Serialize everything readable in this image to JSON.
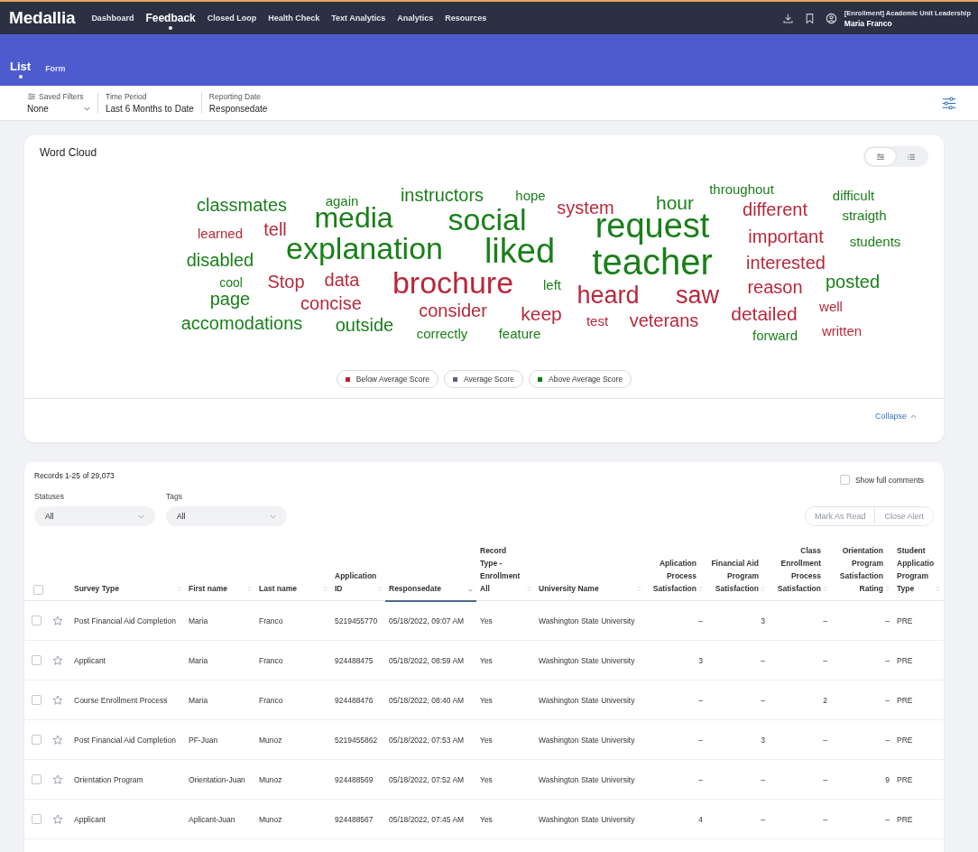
{
  "nav": {
    "logo": "Medallia",
    "items": [
      {
        "label": "Dashboard",
        "selected": false
      },
      {
        "label": "Feedback",
        "selected": true
      },
      {
        "label": "Closed Loop",
        "selected": false
      },
      {
        "label": "Health Check",
        "selected": false
      },
      {
        "label": "Text Analytics",
        "selected": false
      },
      {
        "label": "Analytics",
        "selected": false
      },
      {
        "label": "Resources",
        "selected": false
      }
    ],
    "account": "[Enrollment] Academic Unit Leadership",
    "user": "Maria Franco"
  },
  "subtabs": [
    {
      "label": "List",
      "selected": true
    },
    {
      "label": "Form",
      "selected": false
    }
  ],
  "filters": [
    {
      "label": "Saved Filters",
      "value": "None",
      "kind": "dropdown"
    },
    {
      "label": "Time Period",
      "value": "Last 6 Months to Date",
      "kind": "text"
    },
    {
      "label": "Reporting Date",
      "value": "Responsedate",
      "kind": "text"
    }
  ],
  "word_cloud": {
    "title": "Word Cloud",
    "views": [
      {
        "selected": true
      },
      {
        "selected": false
      }
    ],
    "words": [
      {
        "text": "classmates",
        "color": "#1a7f1a"
      },
      {
        "text": "again",
        "color": "#1a7f1a"
      },
      {
        "text": "instructors",
        "color": "#1a7f1a"
      },
      {
        "text": "hope",
        "color": "#1a7f1a"
      },
      {
        "text": "system",
        "color": "#b8283a"
      },
      {
        "text": "hour",
        "color": "#1a7f1a"
      },
      {
        "text": "throughout",
        "color": "#1a7f1a"
      },
      {
        "text": "difficult",
        "color": "#1a7f1a"
      },
      {
        "text": "media",
        "color": "#1a7f1a"
      },
      {
        "text": "social",
        "color": "#1a7f1a"
      },
      {
        "text": "request",
        "color": "#1a7f1a"
      },
      {
        "text": "different",
        "color": "#b8283a"
      },
      {
        "text": "straigth",
        "color": "#1a7f1a"
      },
      {
        "text": "learned",
        "color": "#b8283a"
      },
      {
        "text": "tell",
        "color": "#b8283a"
      },
      {
        "text": "explanation",
        "color": "#1a7f1a"
      },
      {
        "text": "liked",
        "color": "#1a7f1a"
      },
      {
        "text": "teacher",
        "color": "#1a7f1a"
      },
      {
        "text": "important",
        "color": "#b8283a"
      },
      {
        "text": "students",
        "color": "#1a7f1a"
      },
      {
        "text": "disabled",
        "color": "#1a7f1a"
      },
      {
        "text": "interested",
        "color": "#b8283a"
      },
      {
        "text": "cool",
        "color": "#1a7f1a"
      },
      {
        "text": "Stop",
        "color": "#b8283a"
      },
      {
        "text": "data",
        "color": "#b8283a"
      },
      {
        "text": "brochure",
        "color": "#b8283a"
      },
      {
        "text": "left",
        "color": "#1a7f1a"
      },
      {
        "text": "heard",
        "color": "#b8283a"
      },
      {
        "text": "saw",
        "color": "#b8283a"
      },
      {
        "text": "reason",
        "color": "#b8283a"
      },
      {
        "text": "posted",
        "color": "#1a7f1a"
      },
      {
        "text": "page",
        "color": "#1a7f1a"
      },
      {
        "text": "concise",
        "color": "#b8283a"
      },
      {
        "text": "consider",
        "color": "#b8283a"
      },
      {
        "text": "keep",
        "color": "#b8283a"
      },
      {
        "text": "detailed",
        "color": "#b8283a"
      },
      {
        "text": "well",
        "color": "#b8283a"
      },
      {
        "text": "accomodations",
        "color": "#1a7f1a"
      },
      {
        "text": "outside",
        "color": "#1a7f1a"
      },
      {
        "text": "correctly",
        "color": "#1a7f1a"
      },
      {
        "text": "feature",
        "color": "#1a7f1a"
      },
      {
        "text": "test",
        "color": "#b8283a"
      },
      {
        "text": "veterans",
        "color": "#b8283a"
      },
      {
        "text": "forward",
        "color": "#1a7f1a"
      },
      {
        "text": "written",
        "color": "#b8283a"
      }
    ],
    "legend": [
      {
        "label": "Below Average Score",
        "color": "#b5242f"
      },
      {
        "label": "Average Score",
        "color": "#5b6272"
      },
      {
        "label": "Above Average Score",
        "color": "#0f7a0f"
      }
    ],
    "collapse": "Collapse"
  },
  "records": {
    "summary": "Records 1-25 of 29,073",
    "show_full_comments": {
      "label": "Show full comments",
      "checked": false
    },
    "filters": [
      {
        "label": "Statuses",
        "value": "All"
      },
      {
        "label": "Tags",
        "value": "All"
      }
    ],
    "actions": [
      {
        "label": "Mark As Read",
        "disabled": true
      },
      {
        "label": "Close Alert",
        "disabled": true
      }
    ],
    "select_all_checked": false,
    "columns": [
      {
        "label": "Survey Type",
        "selected": false
      },
      {
        "label": "First name",
        "selected": false
      },
      {
        "label": "Last name",
        "selected": false
      },
      {
        "label": "Application ID",
        "selected": false
      },
      {
        "label": "Responsedate",
        "selected": true
      },
      {
        "label": "Record Type - Enrollment All",
        "selected": false
      },
      {
        "label": "University Name",
        "selected": false
      },
      {
        "label": "Aplication Process Satisfaction",
        "selected": false
      },
      {
        "label": "Financial Aid Program Satisfaction",
        "selected": false
      },
      {
        "label": "Class Enrollment Process Satisfaction",
        "selected": false
      },
      {
        "label": "Orientation Program Satisfaction Rating",
        "selected": false
      },
      {
        "label": "Student Applicatio Program Type",
        "selected": false
      }
    ],
    "rows": [
      {
        "checked": false,
        "starred": false,
        "cells": [
          "Post Financial Aid Completion",
          "Maria",
          "Franco",
          "5219455770",
          "05/18/2022, 09:07 AM",
          "Yes",
          "Washington State University",
          "–",
          "3",
          "–",
          "–",
          "PRE"
        ]
      },
      {
        "checked": false,
        "starred": false,
        "cells": [
          "Applicant",
          "Maria",
          "Franco",
          "924488475",
          "05/18/2022, 08:59 AM",
          "Yes",
          "Washington State University",
          "3",
          "–",
          "–",
          "–",
          "PRE"
        ]
      },
      {
        "checked": false,
        "starred": false,
        "cells": [
          "Course Enrollment Process",
          "Maria",
          "Franco",
          "924488476",
          "05/18/2022, 08:40 AM",
          "Yes",
          "Washington State University",
          "–",
          "–",
          "2",
          "–",
          "PRE"
        ]
      },
      {
        "checked": false,
        "starred": false,
        "cells": [
          "Post Financial Aid Completion",
          "PF-Juan",
          "Munoz",
          "5219455862",
          "05/18/2022, 07:53 AM",
          "Yes",
          "Washington State University",
          "–",
          "3",
          "–",
          "–",
          "PRE"
        ]
      },
      {
        "checked": false,
        "starred": false,
        "cells": [
          "Orientation Program",
          "Orientation-Juan",
          "Munoz",
          "924488569",
          "05/18/2022, 07:52 AM",
          "Yes",
          "Washington State University",
          "–",
          "–",
          "–",
          "9",
          "PRE"
        ]
      },
      {
        "checked": false,
        "starred": false,
        "cells": [
          "Applicant",
          "Aplicant-Juan",
          "Munoz",
          "924488567",
          "05/18/2022, 07:45 AM",
          "Yes",
          "Washington State University",
          "4",
          "–",
          "–",
          "–",
          "PRE"
        ]
      }
    ]
  }
}
